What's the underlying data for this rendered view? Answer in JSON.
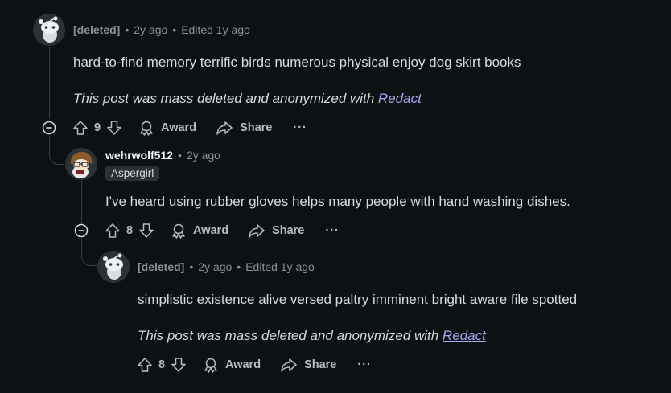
{
  "comments": [
    {
      "author": "[deleted]",
      "time": "2y ago",
      "edited": "Edited 1y ago",
      "body": "hard-to-find memory terrific birds numerous physical enjoy dog skirt books",
      "note_prefix": "This post was mass deleted and anonymized with ",
      "note_link": "Redact",
      "score": "9",
      "award_label": "Award",
      "share_label": "Share",
      "more_label": "···",
      "avatar_icon": "snoo-deleted-avatar-icon"
    },
    {
      "author": "wehrwolf512",
      "time": "2y ago",
      "flair": "Aspergirl",
      "body": "I've heard using rubber gloves helps many people with hand washing dishes.",
      "score": "8",
      "award_label": "Award",
      "share_label": "Share",
      "more_label": "···",
      "avatar_icon": "snoo-custom-avatar-icon"
    },
    {
      "author": "[deleted]",
      "time": "2y ago",
      "edited": "Edited 1y ago",
      "body": "simplistic existence alive versed paltry imminent bright aware file spotted",
      "note_prefix": "This post was mass deleted and anonymized with ",
      "note_link": "Redact",
      "score": "8",
      "award_label": "Award",
      "share_label": "Share",
      "more_label": "···",
      "avatar_icon": "snoo-deleted-avatar-icon"
    }
  ],
  "colors": {
    "background": "#0e1113",
    "text": "#d7dadc",
    "meta": "#8b9196",
    "link": "#a3a8ef",
    "thread_line": "#3a3f42"
  }
}
